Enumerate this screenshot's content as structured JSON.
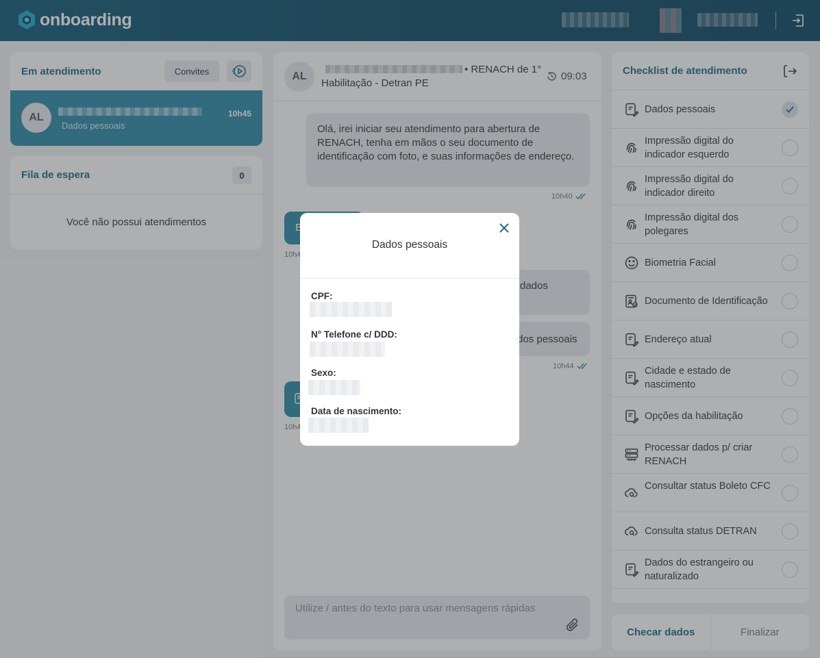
{
  "header": {
    "brand": "onboarding"
  },
  "queue": {
    "active_title": "Em atendimento",
    "invites_label": "Convites",
    "active_item": {
      "initials": "AL",
      "status": "Dados pessoais",
      "time": "10h45"
    },
    "waiting_title": "Fila de espera",
    "waiting_count": "0",
    "empty_message": "Você não possui atendimentos"
  },
  "chat": {
    "contact_initials": "AL",
    "title_line1": "• RENACH de 1°",
    "title_line2": "Habilitação - Detran PE",
    "timer": "09:03",
    "messages": {
      "m1_text": "Olá, irei iniciar seu atendimento para abertura de RENACH, tenha em mãos o seu documento de identificação com foto, e suas informações de endereço.",
      "m1_time": "10h40",
      "m2_prefix": "B",
      "m2_time": "10h4",
      "m3_text": "dados",
      "m4_text": "dos pessoais",
      "m4_time": "10h44",
      "m5_time": "10h4"
    },
    "composer_placeholder": "Utilize / antes do texto para usar mensagens rápidas"
  },
  "checklist": {
    "title": "Checklist de atendimento",
    "items": [
      {
        "label": "Dados pessoais",
        "icon": "form-icon",
        "done": true
      },
      {
        "label": "Impressão digital do indicador esquerdo",
        "icon": "fingerprint-icon",
        "done": false
      },
      {
        "label": "Impressão digital do indicador direito",
        "icon": "fingerprint-icon",
        "done": false
      },
      {
        "label": "Impressão digital dos polegares",
        "icon": "fingerprint-icon",
        "done": false
      },
      {
        "label": "Biometria Facial",
        "icon": "face-icon",
        "done": false
      },
      {
        "label": "Documento de Identificação",
        "icon": "id-card-icon",
        "done": false
      },
      {
        "label": "Endereço atual",
        "icon": "form-icon",
        "done": false
      },
      {
        "label": "Cidade e estado de nascimento",
        "icon": "form-icon",
        "done": false
      },
      {
        "label": "Opções da habilitação",
        "icon": "form-icon",
        "done": false
      },
      {
        "label": "Processar dados p/ criar RENACH",
        "icon": "server-icon",
        "done": false
      },
      {
        "label": "Consultar status Boleto CFC",
        "icon": "cloud-search-icon",
        "done": false
      },
      {
        "label": "Consulta status DETRAN",
        "icon": "cloud-search-icon",
        "done": false
      },
      {
        "label": "Dados do estrangeiro ou naturalizado",
        "icon": "form-icon",
        "done": false
      }
    ],
    "check_button": "Checar dados",
    "finish_button": "Finalizar"
  },
  "modal": {
    "title": "Dados pessoais",
    "fields": [
      {
        "label": "CPF:"
      },
      {
        "label": "N° Telefone c/ DDD:"
      },
      {
        "label": "Sexo:"
      },
      {
        "label": "Data de nascimento:"
      }
    ]
  },
  "colors": {
    "header_bg": "#0c4a63",
    "accent": "#2a8aa6",
    "title_teal": "#1b6a86"
  }
}
